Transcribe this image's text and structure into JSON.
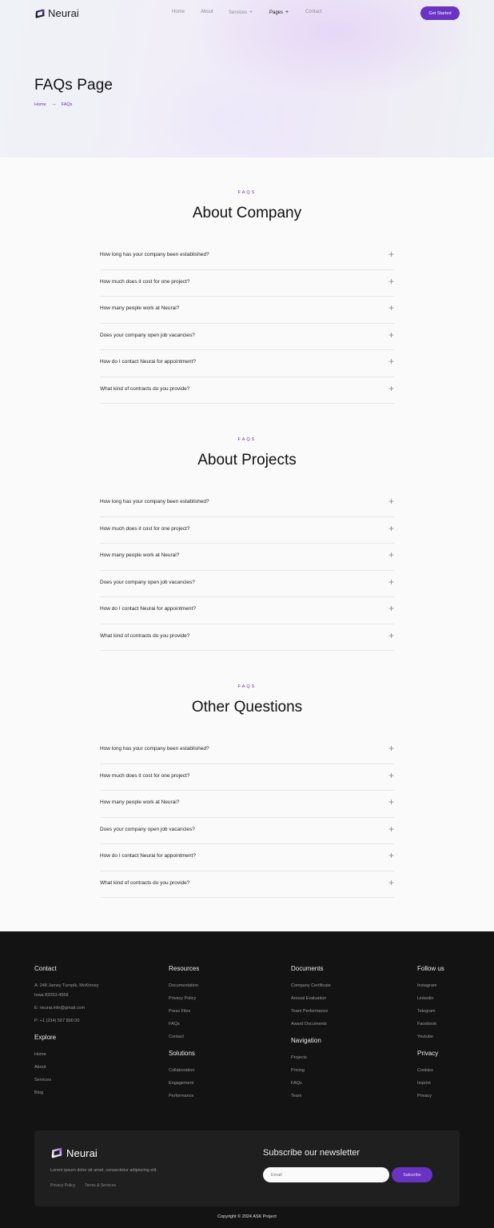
{
  "brand": {
    "name": "Neurai",
    "accent_color": "#6a33c4"
  },
  "nav": {
    "links": [
      {
        "label": "Home",
        "has_plus": false
      },
      {
        "label": "About",
        "has_plus": false
      },
      {
        "label": "Services",
        "has_plus": true
      },
      {
        "label": "Pages",
        "has_plus": true,
        "active": true
      },
      {
        "label": "Contact",
        "has_plus": false
      }
    ],
    "cta_label": "Get Started"
  },
  "hero": {
    "title": "FAQs Page",
    "breadcrumb": [
      "Home",
      "FAQs"
    ]
  },
  "faq_sections": [
    {
      "eyebrow": "FAQS",
      "heading": "About Company",
      "questions": [
        "How long has your company been established?",
        "How much does it cost for one project?",
        "How many people work at Neurai?",
        "Does your company open job vacancies?",
        "How do I contact Neurai for appointment?",
        "What kind of contracts do you provide?"
      ]
    },
    {
      "eyebrow": "FAQS",
      "heading": "About Projects",
      "questions": [
        "How long has your company been established?",
        "How much does it cost for one project?",
        "How many people work at Neurai?",
        "Does your company open job vacancies?",
        "How do I contact Neurai for appointment?",
        "What kind of contracts do you provide?"
      ]
    },
    {
      "eyebrow": "FAQS",
      "heading": "Other Questions",
      "questions": [
        "How long has your company been established?",
        "How much does it cost for one project?",
        "How many people work at Neurai?",
        "Does your company open job vacancies?",
        "How do I contact Neurai for appointment?",
        "What kind of contracts do you provide?"
      ]
    }
  ],
  "footer": {
    "contact": {
      "heading": "Contact",
      "address_line1": "A: 248 Jamey Turnpik, McKinney",
      "address_line2": "Iowa 82053-4558",
      "email": "E: neurai.info@gmail.com",
      "phone": "P: +1 (234) 567 890 00"
    },
    "explore": {
      "heading": "Explore",
      "links": [
        "Home",
        "About",
        "Services",
        "Blog"
      ]
    },
    "resources": {
      "heading": "Resources",
      "links": [
        "Documentation",
        "Privacy Policy",
        "Press Files",
        "FAQs",
        "Contact"
      ]
    },
    "solutions": {
      "heading": "Solutions",
      "links": [
        "Collaboration",
        "Engagement",
        "Performance"
      ]
    },
    "documents": {
      "heading": "Documents",
      "links": [
        "Company Certificate",
        "Annual Evaluation",
        "Team Performance",
        "Award Documents"
      ]
    },
    "navigation": {
      "heading": "Navigation",
      "links": [
        "Projects",
        "Pricing",
        "FAQs",
        "Team"
      ]
    },
    "follow": {
      "heading": "Follow us",
      "links": [
        "Instagram",
        "Linkedin",
        "Telegram",
        "Facebook",
        "Youtube"
      ]
    },
    "privacy": {
      "heading": "Privacy",
      "links": [
        "Cookies",
        "Imprint",
        "Privacy"
      ]
    },
    "newsletter": {
      "description": "Lorem ipsum dolor sit amet, consectetur adipiscing elit.",
      "links": [
        "Privacy Policy",
        "Terms & Services"
      ],
      "title": "Subscribe our newsletter",
      "email_placeholder": "Email",
      "button_label": "Subscribe"
    },
    "copyright": "Copyright © 2024 ASK Project"
  }
}
